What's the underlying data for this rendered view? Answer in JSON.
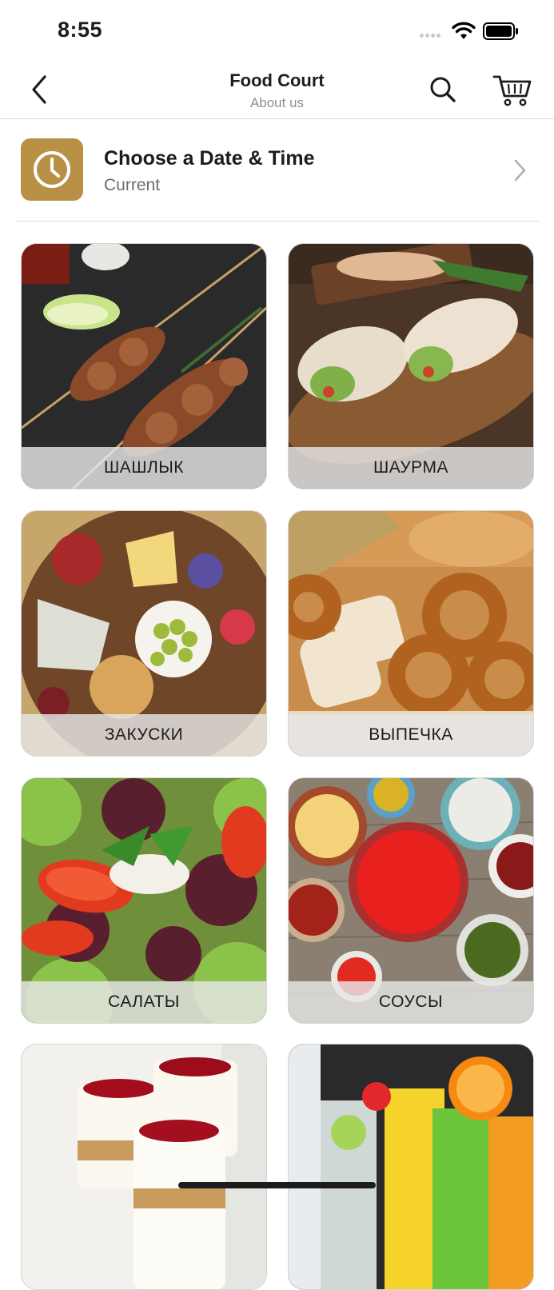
{
  "status": {
    "time": "8:55"
  },
  "nav": {
    "title": "Food Court",
    "subtitle": "About us"
  },
  "date_picker": {
    "title": "Choose a Date & Time",
    "value": "Current"
  },
  "colors": {
    "accent": "#b99146",
    "label_bar": "#e6e6e6"
  },
  "icons": {
    "back": "chevron-left-icon",
    "search": "search-icon",
    "cart": "cart-icon",
    "clock": "clock-icon",
    "disclosure": "chevron-right-icon"
  },
  "categories": [
    {
      "label": "ШАШЛЫК",
      "image": "kebab-skewers-photo"
    },
    {
      "label": "ШАУРМА",
      "image": "shawarma-wraps-photo"
    },
    {
      "label": "ЗАКУСКИ",
      "image": "snack-platter-photo"
    },
    {
      "label": "ВЫПЕЧКА",
      "image": "bakery-bread-photo"
    },
    {
      "label": "САЛАТЫ",
      "image": "salad-photo"
    },
    {
      "label": "СОУСЫ",
      "image": "sauces-photo"
    },
    {
      "label": "",
      "image": "cherry-desserts-photo"
    },
    {
      "label": "",
      "image": "fruit-drinks-photo"
    }
  ]
}
